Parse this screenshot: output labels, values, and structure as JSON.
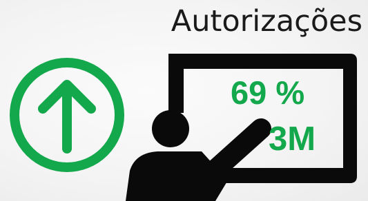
{
  "slide": {
    "title": "Autorizações",
    "stats": {
      "percent": "69 %",
      "amount": "3M"
    },
    "icons": {
      "trend": "arrow-up-circle-icon",
      "presenter": "presenter-at-board-icon"
    },
    "colors": {
      "accent": "#13a84b",
      "icon_dark": "#0a0a0a",
      "title_text": "#1a1a1a",
      "background": "#f4f4f4"
    }
  }
}
